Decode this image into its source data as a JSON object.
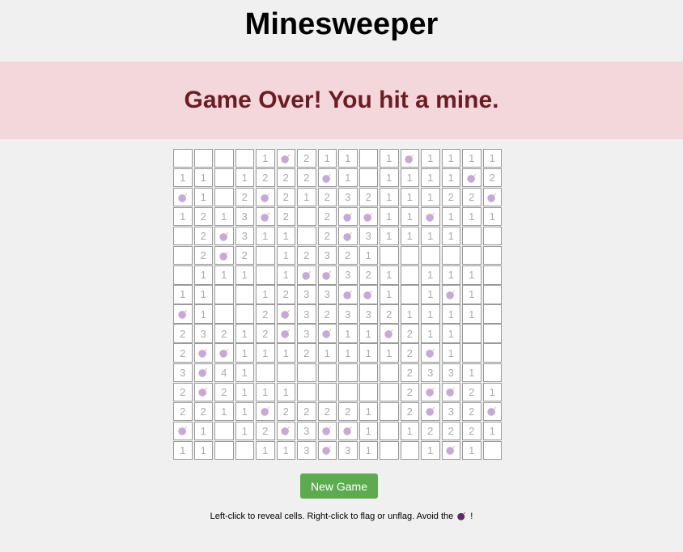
{
  "title": "Minesweeper",
  "status_message": "Game Over! You hit a mine.",
  "new_game_label": "New Game",
  "instructions_before": "Left-click to reveal cells. Right-click to flag or unflag. Avoid the",
  "instructions_after": "!",
  "icons": {
    "mine": "bomb-icon"
  },
  "colors": {
    "background": "#f0f0f0",
    "banner_bg": "#f4d7da",
    "banner_text": "#6b1c24",
    "button": "#5cac4f",
    "number": "#aaaaaa",
    "mine": "#c7a9d6"
  },
  "board": {
    "rows": 16,
    "cols": 16,
    "cells": [
      [
        "",
        "",
        "",
        "",
        "1",
        "*",
        "2",
        "1",
        "1",
        "",
        "1",
        "*",
        "1",
        "1",
        "1",
        "1"
      ],
      [
        "1",
        "1",
        "",
        "1",
        "2",
        "2",
        "2",
        "*",
        "1",
        "",
        "1",
        "1",
        "1",
        "1",
        "*",
        "2"
      ],
      [
        "*",
        "1",
        "",
        "2",
        "*",
        "2",
        "1",
        "2",
        "3",
        "2",
        "1",
        "1",
        "1",
        "2",
        "2",
        "*"
      ],
      [
        "1",
        "2",
        "1",
        "3",
        "*",
        "2",
        "",
        "2",
        "*",
        "*",
        "1",
        "1",
        "*",
        "1",
        "1",
        "1"
      ],
      [
        "",
        "2",
        "*",
        "3",
        "1",
        "1",
        "",
        "2",
        "*",
        "3",
        "1",
        "1",
        "1",
        "1",
        "",
        ""
      ],
      [
        "",
        "2",
        "*",
        "2",
        "",
        "1",
        "2",
        "3",
        "2",
        "1",
        "",
        "",
        "",
        "",
        "",
        ""
      ],
      [
        "",
        "1",
        "1",
        "1",
        "",
        "1",
        "*",
        "*",
        "3",
        "2",
        "1",
        "",
        "1",
        "1",
        "1",
        ""
      ],
      [
        "1",
        "1",
        "",
        "",
        "1",
        "2",
        "3",
        "3",
        "*",
        "*",
        "1",
        "",
        "1",
        "*",
        "1",
        ""
      ],
      [
        "*",
        "1",
        "",
        "",
        "2",
        "*",
        "3",
        "2",
        "3",
        "3",
        "2",
        "1",
        "1",
        "1",
        "1",
        ""
      ],
      [
        "2",
        "3",
        "2",
        "1",
        "2",
        "*",
        "3",
        "*",
        "1",
        "1",
        "*",
        "2",
        "1",
        "1",
        "",
        ""
      ],
      [
        "2",
        "*",
        "*",
        "1",
        "1",
        "1",
        "2",
        "1",
        "1",
        "1",
        "1",
        "2",
        "*",
        "1",
        "",
        ""
      ],
      [
        "3",
        "*",
        "4",
        "1",
        "",
        "",
        "",
        "",
        "",
        "",
        "",
        "2",
        "3",
        "3",
        "1",
        ""
      ],
      [
        "2",
        "*",
        "2",
        "1",
        "1",
        "1",
        "",
        "",
        "",
        "",
        "",
        "2",
        "*",
        "*",
        "2",
        "1"
      ],
      [
        "2",
        "2",
        "1",
        "1",
        "*",
        "2",
        "2",
        "2",
        "2",
        "1",
        "",
        "2",
        "*",
        "3",
        "2",
        "*"
      ],
      [
        "*",
        "1",
        "",
        "1",
        "2",
        "*",
        "3",
        "*",
        "*",
        "1",
        "",
        "1",
        "2",
        "2",
        "2",
        "1"
      ],
      [
        "1",
        "1",
        "",
        "",
        "1",
        "1",
        "3",
        "*",
        "3",
        "1",
        "",
        "",
        "1",
        "*",
        "1",
        ""
      ]
    ]
  }
}
